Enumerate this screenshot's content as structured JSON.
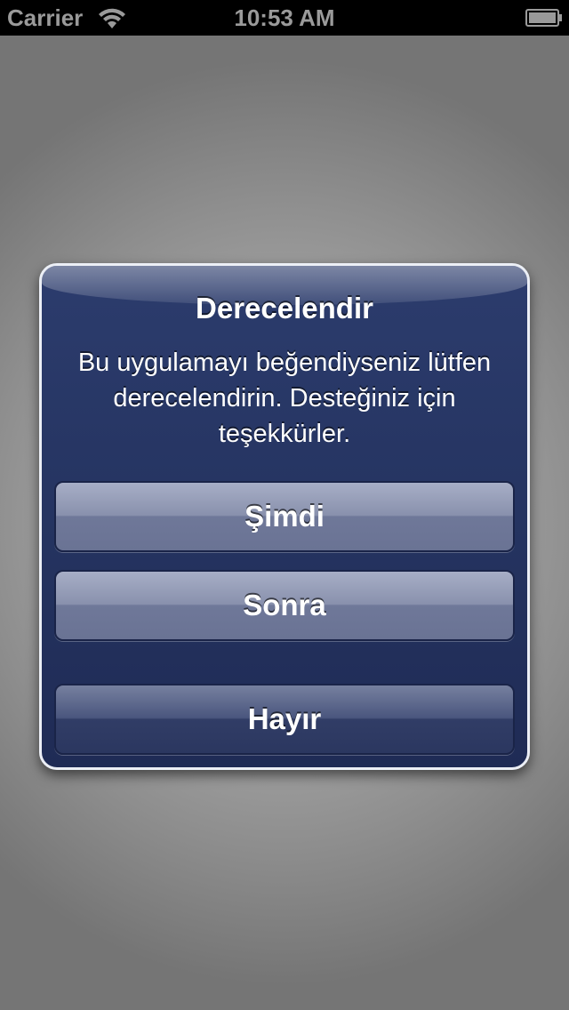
{
  "status_bar": {
    "carrier": "Carrier",
    "time": "10:53 AM",
    "icons": [
      "wifi-icon",
      "battery-icon"
    ]
  },
  "alert": {
    "title": "Derecelendir",
    "message": "Bu uygulamayı beğendiyseniz lütfen derecelendirin. Desteğiniz için teşekkürler.",
    "buttons": [
      {
        "label": "Şimdi"
      },
      {
        "label": "Sonra"
      },
      {
        "label": "Hayır"
      }
    ]
  },
  "colors": {
    "alert_background": "#253461",
    "alert_border": "#eceff6",
    "backdrop": "#a9a9a9"
  }
}
